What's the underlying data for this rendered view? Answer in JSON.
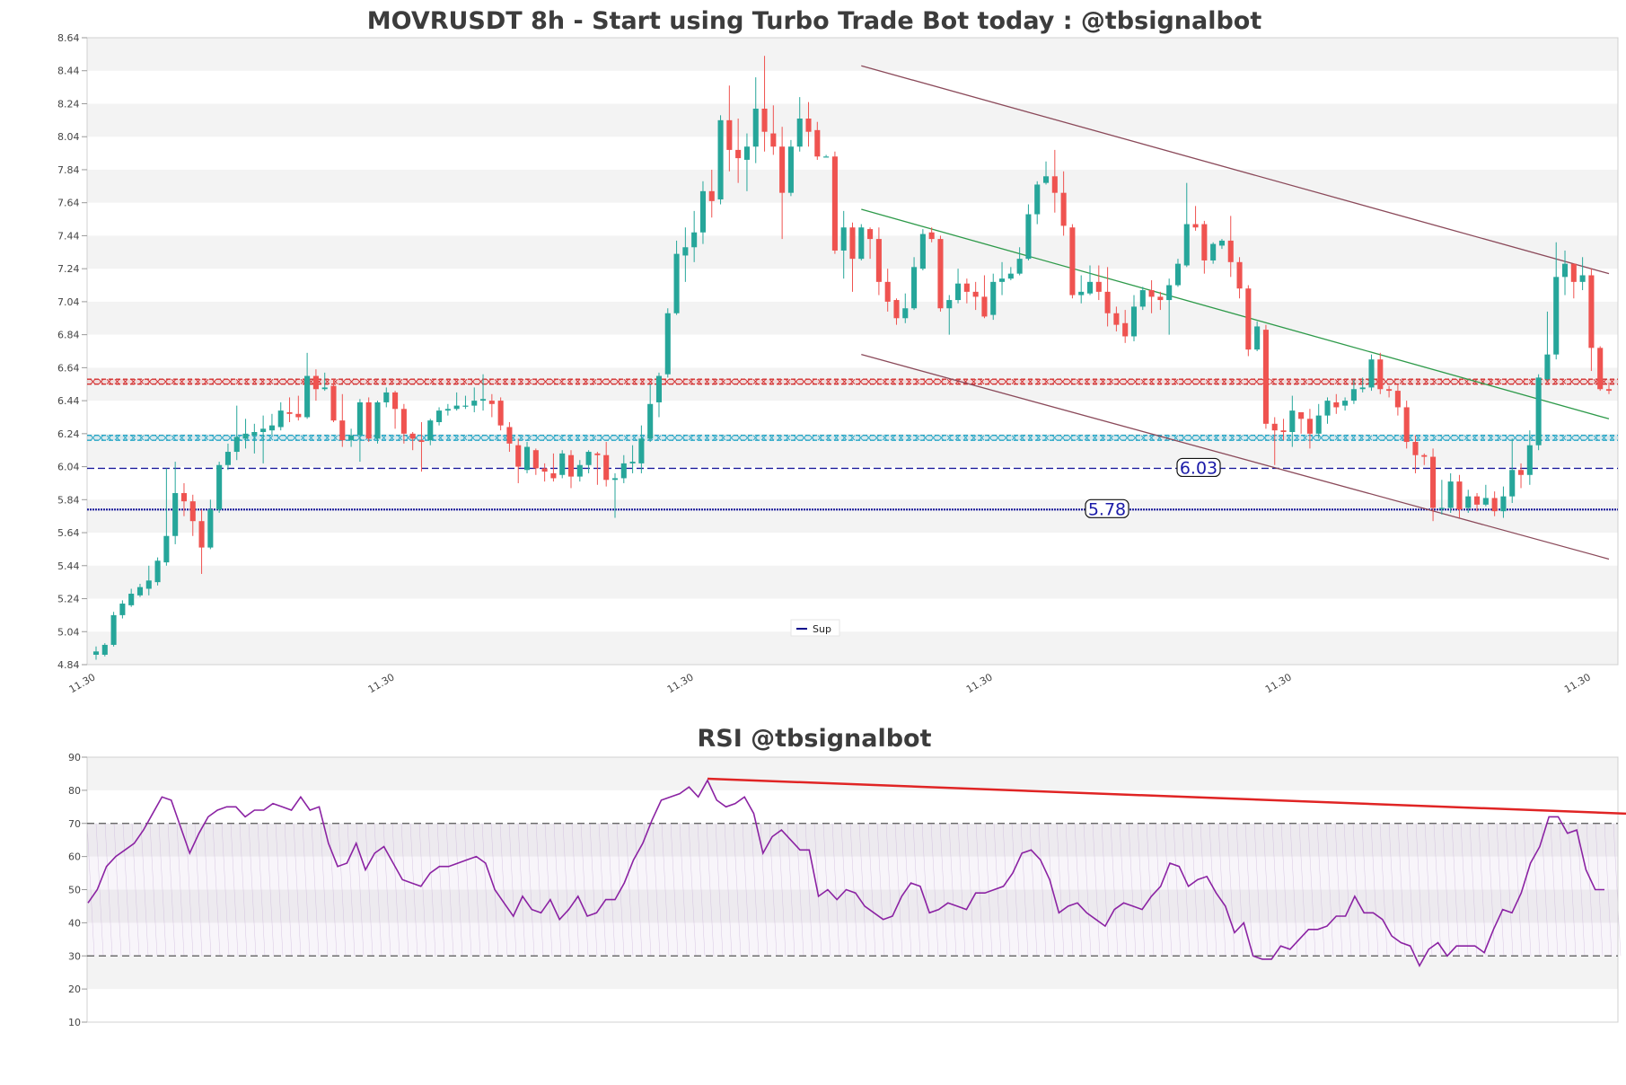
{
  "chart_data": [
    {
      "type": "candlestick",
      "title": "MOVRUSDT 8h - Start using Turbo Trade Bot today : @tbsignalbot",
      "ylim": [
        4.84,
        8.64
      ],
      "y_ticks": [
        "4.84",
        "5.04",
        "5.24",
        "5.44",
        "5.64",
        "5.84",
        "6.04",
        "6.24",
        "6.44",
        "6.64",
        "6.84",
        "7.04",
        "7.24",
        "7.44",
        "7.64",
        "7.84",
        "8.04",
        "8.24",
        "8.44",
        "8.64"
      ],
      "x_ticks": [
        "11.30",
        "11.30",
        "11.30",
        "11.30",
        "11.30",
        "11.30"
      ],
      "grid": "alternating horizontal bands",
      "legend": {
        "position": "bottom-center",
        "entries": [
          {
            "name": "Sup",
            "color": "#0a0a8c"
          }
        ]
      },
      "colors": {
        "up": "#26a69a",
        "down": "#ef5350",
        "resistance": "#d32f2f",
        "support": "#26a6c6",
        "channel": "#8b4a5a",
        "trend": "#2e9a4a",
        "level": "#1a1a9a"
      },
      "candles": [
        [
          4.9,
          4.92,
          4.87,
          4.95
        ],
        [
          4.9,
          4.96,
          4.89,
          4.97
        ],
        [
          4.96,
          5.14,
          4.95,
          5.16
        ],
        [
          5.14,
          5.21,
          5.12,
          5.23
        ],
        [
          5.2,
          5.27,
          5.19,
          5.3
        ],
        [
          5.26,
          5.31,
          5.25,
          5.33
        ],
        [
          5.3,
          5.35,
          5.26,
          5.44
        ],
        [
          5.34,
          5.47,
          5.32,
          5.49
        ],
        [
          5.46,
          5.62,
          5.44,
          6.03
        ],
        [
          5.62,
          5.88,
          5.57,
          6.07
        ],
        [
          5.88,
          5.83,
          5.74,
          5.94
        ],
        [
          5.83,
          5.71,
          5.62,
          5.87
        ],
        [
          5.71,
          5.55,
          5.39,
          5.78
        ],
        [
          5.55,
          5.78,
          5.54,
          5.84
        ],
        [
          5.78,
          6.05,
          5.76,
          6.07
        ],
        [
          6.05,
          6.13,
          6.02,
          6.18
        ],
        [
          6.13,
          6.22,
          6.08,
          6.41
        ],
        [
          6.21,
          6.24,
          6.15,
          6.33
        ],
        [
          6.23,
          6.25,
          6.12,
          6.3
        ],
        [
          6.25,
          6.27,
          6.06,
          6.35
        ],
        [
          6.26,
          6.29,
          6.23,
          6.36
        ],
        [
          6.28,
          6.38,
          6.26,
          6.43
        ],
        [
          6.37,
          6.36,
          6.31,
          6.46
        ],
        [
          6.36,
          6.34,
          6.32,
          6.47
        ],
        [
          6.34,
          6.59,
          6.33,
          6.73
        ],
        [
          6.59,
          6.51,
          6.44,
          6.63
        ],
        [
          6.51,
          6.52,
          6.5,
          6.61
        ],
        [
          6.53,
          6.32,
          6.31,
          6.57
        ],
        [
          6.32,
          6.2,
          6.16,
          6.48
        ],
        [
          6.2,
          6.23,
          6.16,
          6.27
        ],
        [
          6.23,
          6.43,
          6.07,
          6.45
        ],
        [
          6.43,
          6.21,
          6.19,
          6.46
        ],
        [
          6.21,
          6.43,
          6.18,
          6.44
        ],
        [
          6.43,
          6.49,
          6.4,
          6.52
        ],
        [
          6.49,
          6.39,
          6.27,
          6.5
        ],
        [
          6.39,
          6.24,
          6.18,
          6.42
        ],
        [
          6.24,
          6.21,
          6.14,
          6.25
        ],
        [
          6.2,
          6.19,
          6.01,
          6.31
        ],
        [
          6.2,
          6.32,
          6.17,
          6.33
        ],
        [
          6.31,
          6.38,
          6.29,
          6.4
        ],
        [
          6.38,
          6.39,
          6.35,
          6.42
        ],
        [
          6.39,
          6.41,
          6.38,
          6.49
        ],
        [
          6.41,
          6.41,
          6.39,
          6.47
        ],
        [
          6.41,
          6.44,
          6.37,
          6.52
        ],
        [
          6.44,
          6.45,
          6.38,
          6.6
        ],
        [
          6.44,
          6.42,
          6.34,
          6.48
        ],
        [
          6.44,
          6.29,
          6.26,
          6.46
        ],
        [
          6.28,
          6.18,
          6.13,
          6.31
        ],
        [
          6.17,
          6.04,
          5.94,
          6.21
        ],
        [
          6.02,
          6.16,
          6.0,
          6.19
        ],
        [
          6.14,
          6.03,
          5.99,
          6.15
        ],
        [
          6.03,
          6.01,
          5.95,
          6.06
        ],
        [
          6.0,
          5.97,
          5.95,
          6.12
        ],
        [
          5.99,
          6.12,
          5.97,
          6.14
        ],
        [
          6.11,
          5.98,
          5.91,
          6.14
        ],
        [
          5.98,
          6.05,
          5.95,
          6.08
        ],
        [
          6.05,
          6.13,
          6.0,
          6.14
        ],
        [
          6.12,
          6.11,
          5.93,
          6.13
        ],
        [
          6.11,
          5.96,
          5.92,
          6.19
        ],
        [
          5.96,
          5.97,
          5.73,
          6.0
        ],
        [
          5.97,
          6.06,
          5.94,
          6.11
        ],
        [
          6.06,
          6.07,
          6.0,
          6.17
        ],
        [
          6.06,
          6.21,
          6.0,
          6.29
        ],
        [
          6.21,
          6.42,
          6.19,
          6.54
        ],
        [
          6.43,
          6.59,
          6.34,
          6.61
        ],
        [
          6.6,
          6.97,
          6.58,
          7.0
        ],
        [
          6.97,
          7.33,
          6.96,
          7.41
        ],
        [
          7.32,
          7.37,
          7.16,
          7.49
        ],
        [
          7.37,
          7.46,
          7.28,
          7.59
        ],
        [
          7.46,
          7.71,
          7.39,
          7.77
        ],
        [
          7.71,
          7.65,
          7.55,
          7.84
        ],
        [
          7.66,
          8.14,
          7.63,
          8.17
        ],
        [
          8.14,
          7.96,
          7.83,
          8.35
        ],
        [
          7.96,
          7.91,
          7.76,
          8.15
        ],
        [
          7.9,
          7.98,
          7.71,
          8.06
        ],
        [
          7.98,
          8.21,
          7.88,
          8.4
        ],
        [
          8.21,
          8.07,
          7.95,
          8.53
        ],
        [
          8.06,
          7.98,
          7.93,
          8.23
        ],
        [
          7.98,
          7.7,
          7.42,
          8.1
        ],
        [
          7.7,
          7.98,
          7.68,
          8.02
        ],
        [
          7.98,
          8.15,
          7.95,
          8.28
        ],
        [
          8.15,
          8.07,
          7.98,
          8.25
        ],
        [
          8.08,
          7.92,
          7.9,
          8.13
        ],
        [
          7.92,
          7.92,
          7.92,
          7.93
        ],
        [
          7.92,
          7.35,
          7.33,
          7.95
        ],
        [
          7.35,
          7.49,
          7.18,
          7.59
        ],
        [
          7.49,
          7.3,
          7.1,
          7.52
        ],
        [
          7.3,
          7.49,
          7.29,
          7.51
        ],
        [
          7.48,
          7.42,
          7.3,
          7.49
        ],
        [
          7.42,
          7.16,
          7.08,
          7.49
        ],
        [
          7.16,
          7.04,
          6.98,
          7.24
        ],
        [
          7.05,
          6.94,
          6.9,
          7.06
        ],
        [
          6.94,
          7.0,
          6.91,
          7.09
        ],
        [
          7.0,
          7.25,
          6.99,
          7.31
        ],
        [
          7.24,
          7.45,
          7.23,
          7.48
        ],
        [
          7.46,
          7.42,
          7.4,
          7.49
        ],
        [
          7.42,
          7.0,
          6.98,
          7.44
        ],
        [
          7.0,
          7.05,
          6.84,
          7.08
        ],
        [
          7.05,
          7.15,
          7.03,
          7.24
        ],
        [
          7.15,
          7.1,
          7.03,
          7.18
        ],
        [
          7.1,
          7.07,
          6.99,
          7.16
        ],
        [
          7.07,
          6.95,
          6.94,
          7.2
        ],
        [
          6.96,
          7.16,
          6.93,
          7.21
        ],
        [
          7.16,
          7.18,
          7.08,
          7.28
        ],
        [
          7.18,
          7.21,
          7.17,
          7.25
        ],
        [
          7.21,
          7.3,
          7.2,
          7.37
        ],
        [
          7.3,
          7.57,
          7.29,
          7.63
        ],
        [
          7.57,
          7.75,
          7.51,
          7.77
        ],
        [
          7.76,
          7.8,
          7.75,
          7.89
        ],
        [
          7.8,
          7.7,
          7.58,
          7.96
        ],
        [
          7.7,
          7.5,
          7.44,
          7.83
        ],
        [
          7.49,
          7.08,
          7.06,
          7.51
        ],
        [
          7.08,
          7.1,
          7.03,
          7.2
        ],
        [
          7.09,
          7.16,
          7.08,
          7.26
        ],
        [
          7.16,
          7.1,
          7.05,
          7.26
        ],
        [
          7.1,
          6.97,
          6.89,
          7.25
        ],
        [
          6.97,
          6.9,
          6.86,
          7.01
        ],
        [
          6.91,
          6.83,
          6.79,
          6.99
        ],
        [
          6.83,
          7.01,
          6.8,
          7.08
        ],
        [
          7.01,
          7.11,
          6.99,
          7.13
        ],
        [
          7.11,
          7.07,
          6.97,
          7.17
        ],
        [
          7.07,
          7.05,
          6.99,
          7.1
        ],
        [
          7.05,
          7.14,
          6.84,
          7.18
        ],
        [
          7.14,
          7.27,
          7.13,
          7.3
        ],
        [
          7.26,
          7.51,
          7.25,
          7.76
        ],
        [
          7.51,
          7.49,
          7.47,
          7.62
        ],
        [
          7.51,
          7.29,
          7.21,
          7.53
        ],
        [
          7.29,
          7.39,
          7.27,
          7.4
        ],
        [
          7.38,
          7.41,
          7.36,
          7.42
        ],
        [
          7.41,
          7.28,
          7.19,
          7.56
        ],
        [
          7.28,
          7.12,
          7.06,
          7.31
        ],
        [
          7.12,
          6.75,
          6.71,
          7.14
        ],
        [
          6.75,
          6.89,
          6.74,
          6.92
        ],
        [
          6.87,
          6.3,
          6.27,
          6.9
        ],
        [
          6.3,
          6.26,
          6.05,
          6.34
        ],
        [
          6.26,
          6.25,
          6.2,
          6.33
        ],
        [
          6.25,
          6.38,
          6.16,
          6.47
        ],
        [
          6.37,
          6.33,
          6.24,
          6.37
        ],
        [
          6.33,
          6.24,
          6.15,
          6.39
        ],
        [
          6.24,
          6.35,
          6.21,
          6.42
        ],
        [
          6.35,
          6.44,
          6.3,
          6.46
        ],
        [
          6.43,
          6.4,
          6.36,
          6.48
        ],
        [
          6.41,
          6.44,
          6.38,
          6.46
        ],
        [
          6.44,
          6.51,
          6.42,
          6.57
        ],
        [
          6.51,
          6.52,
          6.49,
          6.58
        ],
        [
          6.52,
          6.69,
          6.5,
          6.72
        ],
        [
          6.69,
          6.51,
          6.48,
          6.73
        ],
        [
          6.51,
          6.5,
          6.46,
          6.53
        ],
        [
          6.5,
          6.4,
          6.35,
          6.54
        ],
        [
          6.4,
          6.19,
          6.15,
          6.44
        ],
        [
          6.19,
          6.11,
          6.0,
          6.23
        ],
        [
          6.11,
          6.1,
          6.05,
          6.12
        ],
        [
          6.1,
          5.79,
          5.71,
          6.15
        ],
        [
          5.79,
          5.79,
          5.75,
          5.96
        ],
        [
          5.79,
          5.95,
          5.76,
          6.0
        ],
        [
          5.95,
          5.78,
          5.73,
          5.99
        ],
        [
          5.79,
          5.86,
          5.76,
          5.9
        ],
        [
          5.86,
          5.81,
          5.77,
          5.88
        ],
        [
          5.81,
          5.85,
          5.8,
          5.93
        ],
        [
          5.85,
          5.77,
          5.74,
          5.89
        ],
        [
          5.77,
          5.86,
          5.73,
          5.92
        ],
        [
          5.86,
          6.02,
          5.82,
          6.21
        ],
        [
          6.02,
          5.99,
          5.91,
          6.06
        ],
        [
          5.99,
          6.17,
          5.93,
          6.26
        ],
        [
          6.17,
          6.58,
          6.14,
          6.6
        ],
        [
          6.57,
          6.72,
          6.56,
          6.98
        ],
        [
          6.72,
          7.19,
          6.69,
          7.4
        ],
        [
          7.19,
          7.27,
          7.08,
          7.35
        ],
        [
          7.27,
          7.16,
          7.06,
          7.27
        ],
        [
          7.16,
          7.2,
          7.11,
          7.31
        ],
        [
          7.2,
          6.76,
          6.62,
          7.24
        ],
        [
          6.76,
          6.51,
          6.5,
          6.77
        ],
        [
          6.51,
          6.5,
          6.48,
          6.55
        ]
      ],
      "resistance_band": [
        6.54,
        6.57
      ],
      "support_band": [
        6.2,
        6.23
      ],
      "levels": [
        {
          "value": 6.03,
          "label": "6.03"
        },
        {
          "value": 5.78,
          "label": "5.78",
          "series": "Sup"
        }
      ],
      "channel_upper": [
        [
          87,
          8.47
        ],
        [
          172,
          7.21
        ]
      ],
      "channel_lower": [
        [
          87,
          6.72
        ],
        [
          172,
          5.48
        ]
      ],
      "trend_line": [
        [
          87,
          7.6
        ],
        [
          172,
          6.33
        ]
      ]
    },
    {
      "type": "line",
      "title": "RSI @tbsignalbot",
      "ylim": [
        10,
        90
      ],
      "y_ticks": [
        "10",
        "20",
        "30",
        "40",
        "50",
        "60",
        "70",
        "80",
        "90"
      ],
      "reference_lines": [
        30,
        70
      ],
      "series": [
        {
          "color": "#8b23a3",
          "values": [
            46,
            50,
            57,
            60,
            62,
            64,
            68,
            73,
            78,
            77,
            69,
            61,
            67,
            72,
            74,
            75,
            75,
            72,
            74,
            74,
            76,
            75,
            74,
            78,
            74,
            75,
            64,
            57,
            58,
            64,
            56,
            61,
            63,
            58,
            53,
            52,
            51,
            55,
            57,
            57,
            58,
            59,
            60,
            58,
            50,
            46,
            42,
            48,
            44,
            43,
            47,
            41,
            44,
            48,
            42,
            43,
            47,
            47,
            52,
            59,
            64,
            71,
            77,
            78,
            79,
            81,
            78,
            83,
            77,
            75,
            76,
            78,
            73,
            61,
            66,
            68,
            65,
            62,
            62,
            48,
            50,
            47,
            50,
            49,
            45,
            43,
            41,
            42,
            48,
            52,
            51,
            43,
            44,
            46,
            45,
            44,
            49,
            49,
            50,
            51,
            55,
            61,
            62,
            59,
            53,
            43,
            45,
            46,
            43,
            41,
            39,
            44,
            46,
            45,
            44,
            48,
            51,
            58,
            57,
            51,
            53,
            54,
            49,
            45,
            37,
            40,
            30,
            29,
            29,
            33,
            32,
            35,
            38,
            38,
            39,
            42,
            42,
            48,
            43,
            43,
            41,
            36,
            34,
            33,
            27,
            32,
            34,
            30,
            33,
            33,
            33,
            31,
            38,
            44,
            43,
            49,
            58,
            63,
            72,
            72,
            67,
            68,
            56,
            50,
            50
          ]
        }
      ],
      "trend_line": [
        [
          67,
          83.5
        ],
        [
          180,
          71.5
        ]
      ]
    }
  ]
}
